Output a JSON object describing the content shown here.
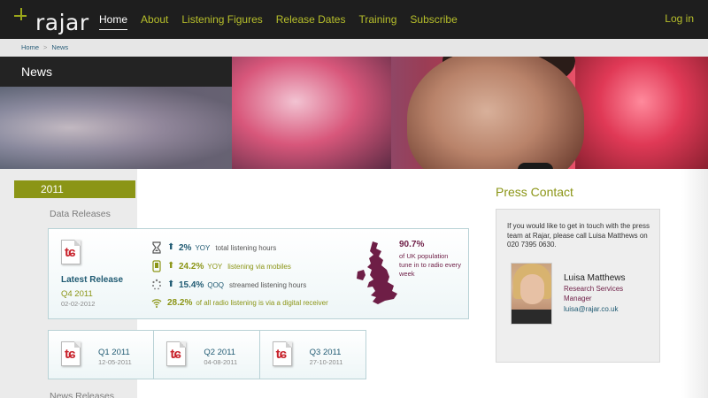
{
  "brand": {
    "logo_text": "rajar",
    "accent": "#8b9516",
    "link": "#1f5a72",
    "plum": "#6e1e46"
  },
  "nav": {
    "items": [
      {
        "label": "Home",
        "active": true
      },
      {
        "label": "About"
      },
      {
        "label": "Listening Figures"
      },
      {
        "label": "Release Dates"
      },
      {
        "label": "Training"
      },
      {
        "label": "Subscribe"
      }
    ],
    "login": "Log in"
  },
  "breadcrumb": {
    "items": [
      "Home",
      "News"
    ],
    "separator": ">"
  },
  "hero": {
    "title": "News"
  },
  "sidebar": {
    "year": "2011",
    "data_releases_label": "Data Releases",
    "news_releases_label": "News Releases"
  },
  "latest_release": {
    "title": "Latest Release",
    "quarter": "Q4 2011",
    "date": "02-02-2012",
    "icon": "pdf-icon",
    "stats": [
      {
        "icon": "hourglass-icon",
        "arrow": "up-arrow-icon",
        "value": "2%",
        "unit": "YOY",
        "desc": "total listening hours",
        "color": "#1f5a72"
      },
      {
        "icon": "mobile-icon",
        "arrow": "up-arrow-icon",
        "value": "24.2%",
        "unit": "YOY",
        "desc": "listening via mobiles",
        "color": "#8b9516"
      },
      {
        "icon": "loading-icon",
        "arrow": "up-arrow-icon",
        "value": "15.4%",
        "unit": "QOQ",
        "desc": "streamed listening hours",
        "color": "#1f5a72"
      },
      {
        "icon": "wifi-icon",
        "value": "28.2%",
        "desc": "of all radio listening is via a digital receiver",
        "color": "#8b9516"
      }
    ],
    "map": {
      "icon": "uk-map-icon",
      "value": "90.7%",
      "desc": "of UK population tune in to radio every week"
    }
  },
  "quarters": [
    {
      "label": "Q1 2011",
      "date": "12-05-2011"
    },
    {
      "label": "Q2 2011",
      "date": "04-08-2011"
    },
    {
      "label": "Q3 2011",
      "date": "27-10-2011"
    }
  ],
  "press_contact": {
    "title": "Press Contact",
    "text": "If you would like to get in touch with the press team at Rajar, please call Luisa Matthews on 020 7395 0630.",
    "name": "Luisa Matthews",
    "role": "Research Services Manager",
    "email": "luisa@rajar.co.uk"
  }
}
